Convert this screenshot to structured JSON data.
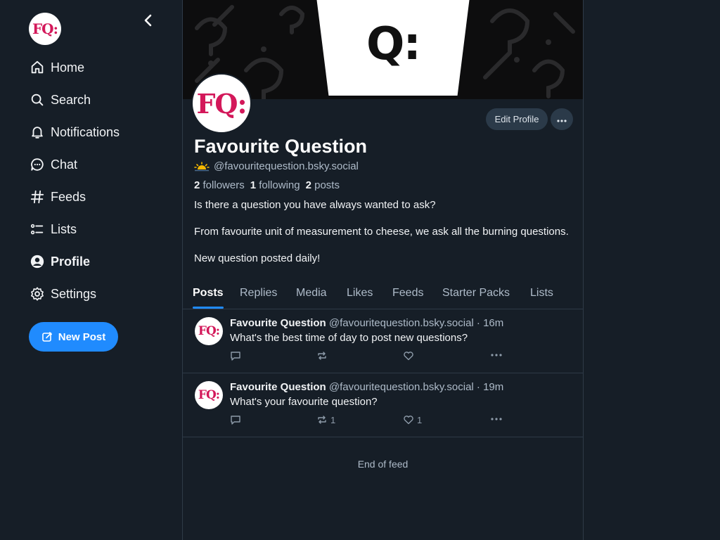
{
  "sidebar": {
    "avatar_text": "FQ:",
    "nav": [
      {
        "label": "Home",
        "icon": "home-icon"
      },
      {
        "label": "Search",
        "icon": "search-icon"
      },
      {
        "label": "Notifications",
        "icon": "bell-icon"
      },
      {
        "label": "Chat",
        "icon": "chat-icon"
      },
      {
        "label": "Feeds",
        "icon": "hash-icon"
      },
      {
        "label": "Lists",
        "icon": "list-icon"
      },
      {
        "label": "Profile",
        "icon": "user-circle-icon",
        "active": true
      },
      {
        "label": "Settings",
        "icon": "gear-icon"
      }
    ],
    "new_post_label": "New Post"
  },
  "profile": {
    "banner_text": "Q:",
    "avatar_text": "FQ:",
    "edit_label": "Edit Profile",
    "display_name": "Favourite Question",
    "handle": "@favouritequestion.bsky.social",
    "followers_count": "2",
    "followers_label": "followers",
    "following_count": "1",
    "following_label": "following",
    "posts_count": "2",
    "posts_label": "posts",
    "bio": [
      "Is there a question you have always wanted to ask?",
      "From favourite unit of measurement to cheese, we ask all the burning questions.",
      "New question posted daily!"
    ]
  },
  "tabs": [
    "Posts",
    "Replies",
    "Media",
    "Likes",
    "Feeds",
    "Starter Packs",
    "Lists"
  ],
  "active_tab": "Posts",
  "posts": [
    {
      "author": "Favourite Question",
      "handle": "@favouritequestion.bsky.social",
      "time": "· 16m",
      "text": "What's the best time of day to post new questions?",
      "reposts": "",
      "likes": ""
    },
    {
      "author": "Favourite Question",
      "handle": "@favouritequestion.bsky.social",
      "time": "· 19m",
      "text": "What's your favourite question?",
      "reposts": "1",
      "likes": "1"
    }
  ],
  "end_of_feed": "End of feed",
  "colors": {
    "accent": "#208bfe",
    "background": "#161e27",
    "brand": "#d3185a"
  }
}
